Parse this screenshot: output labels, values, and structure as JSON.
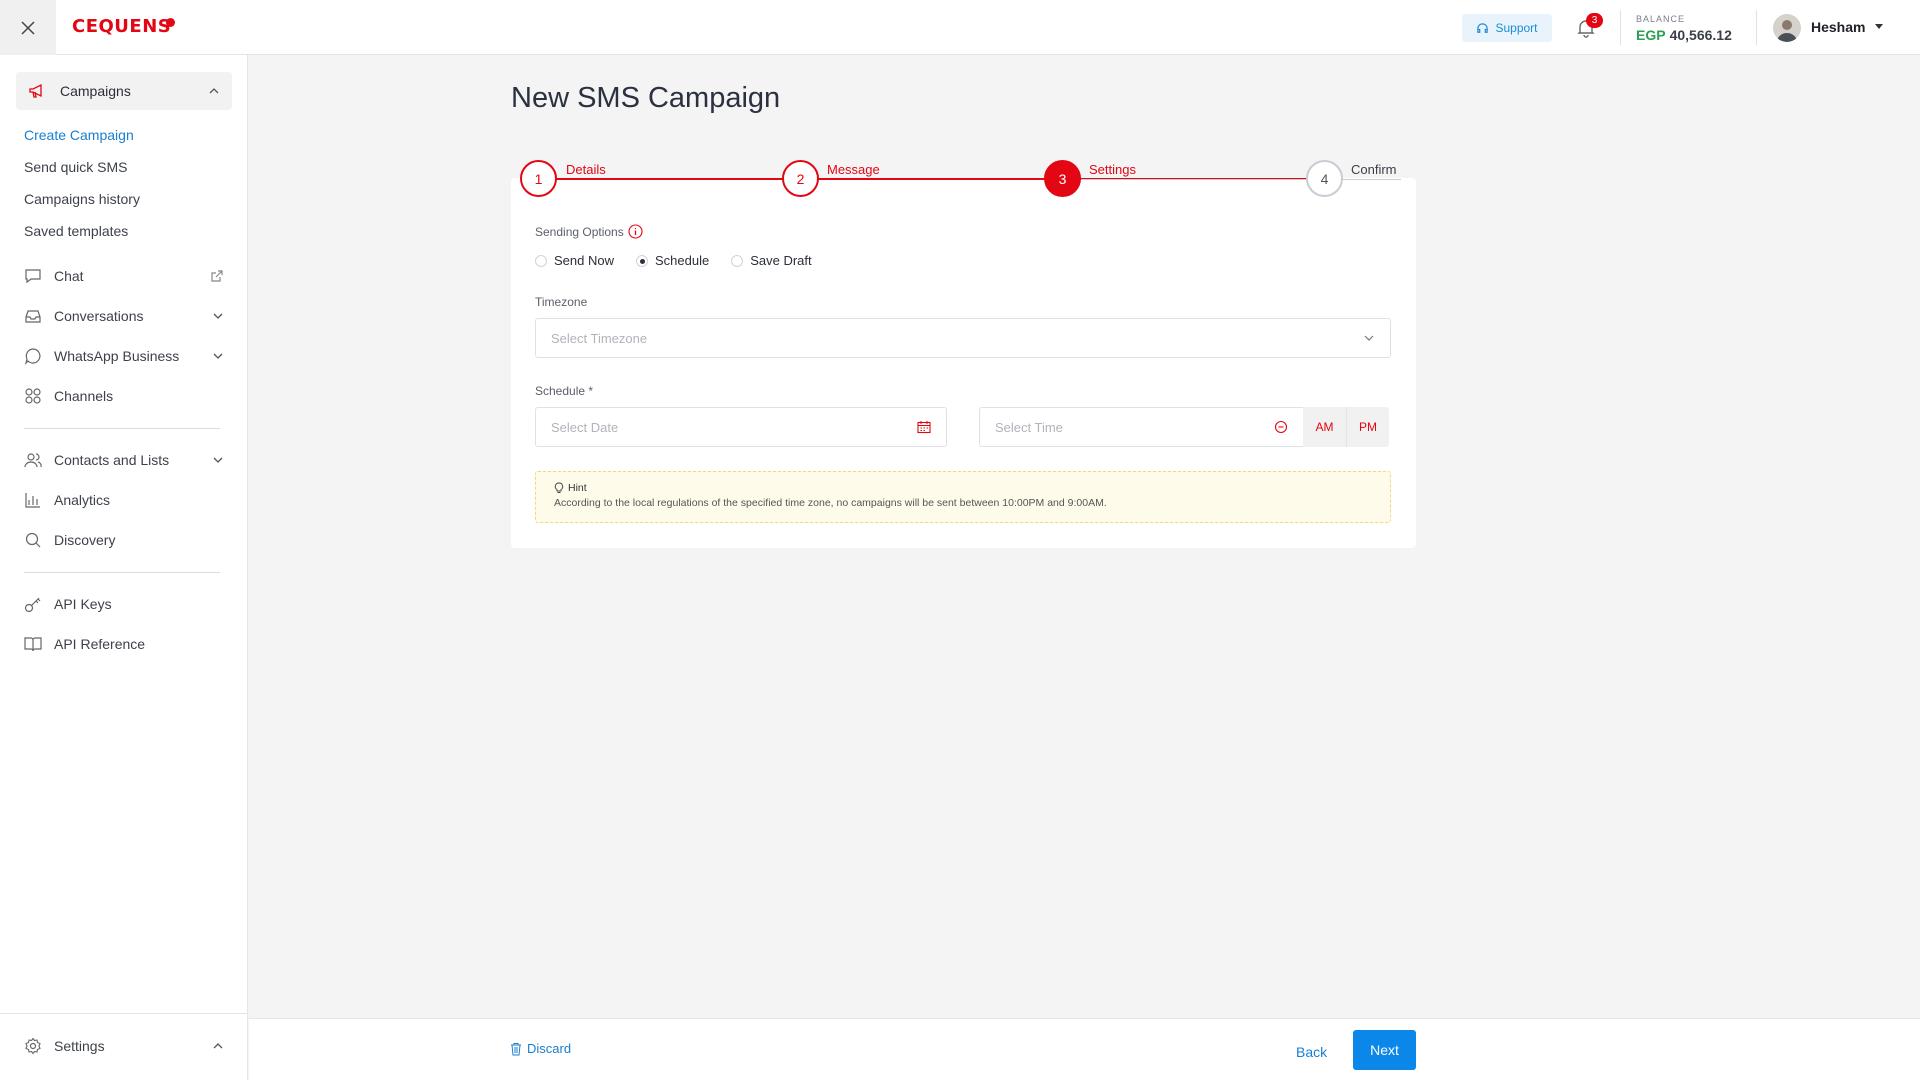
{
  "header": {
    "logo": "CEQUENS",
    "support_label": "Support",
    "notifications_count": "3",
    "balance_label": "BALANCE",
    "balance_currency": "EGP",
    "balance_amount": "40,566.12",
    "username": "Hesham"
  },
  "sidebar": {
    "campaigns_label": "Campaigns",
    "campaign_subitems": [
      "Create Campaign",
      "Send quick SMS",
      "Campaigns history",
      "Saved templates"
    ],
    "items": [
      "Chat",
      "Conversations",
      "WhatsApp Business",
      "Channels",
      "Contacts and Lists",
      "Analytics",
      "Discovery",
      "API Keys",
      "API Reference"
    ],
    "settings_label": "Settings"
  },
  "main": {
    "title": "New SMS Campaign",
    "steps": [
      {
        "number": "1",
        "label": "Details"
      },
      {
        "number": "2",
        "label": "Message"
      },
      {
        "number": "3",
        "label": "Settings"
      },
      {
        "number": "4",
        "label": "Confirm"
      }
    ],
    "sending_options_label": "Sending Options",
    "sending_options": [
      "Send Now",
      "Schedule",
      "Save Draft"
    ],
    "sending_option_selected": "Schedule",
    "timezone_label": "Timezone",
    "timezone_placeholder": "Select Timezone",
    "schedule_label": "Schedule *",
    "date_placeholder": "Select  Date",
    "time_placeholder": "Select Time",
    "am_label": "AM",
    "pm_label": "PM",
    "hint_title": "Hint",
    "hint_text": "According to the local regulations of the specified time zone, no campaigns will be sent between 10:00PM and 9:00AM."
  },
  "footer": {
    "discard_label": "Discard",
    "back_label": "Back",
    "next_label": "Next"
  },
  "colors": {
    "brand": "#e30613",
    "link": "#1a7fd0",
    "primary_button": "#0a87e8",
    "balance_currency": "#2aa053"
  }
}
